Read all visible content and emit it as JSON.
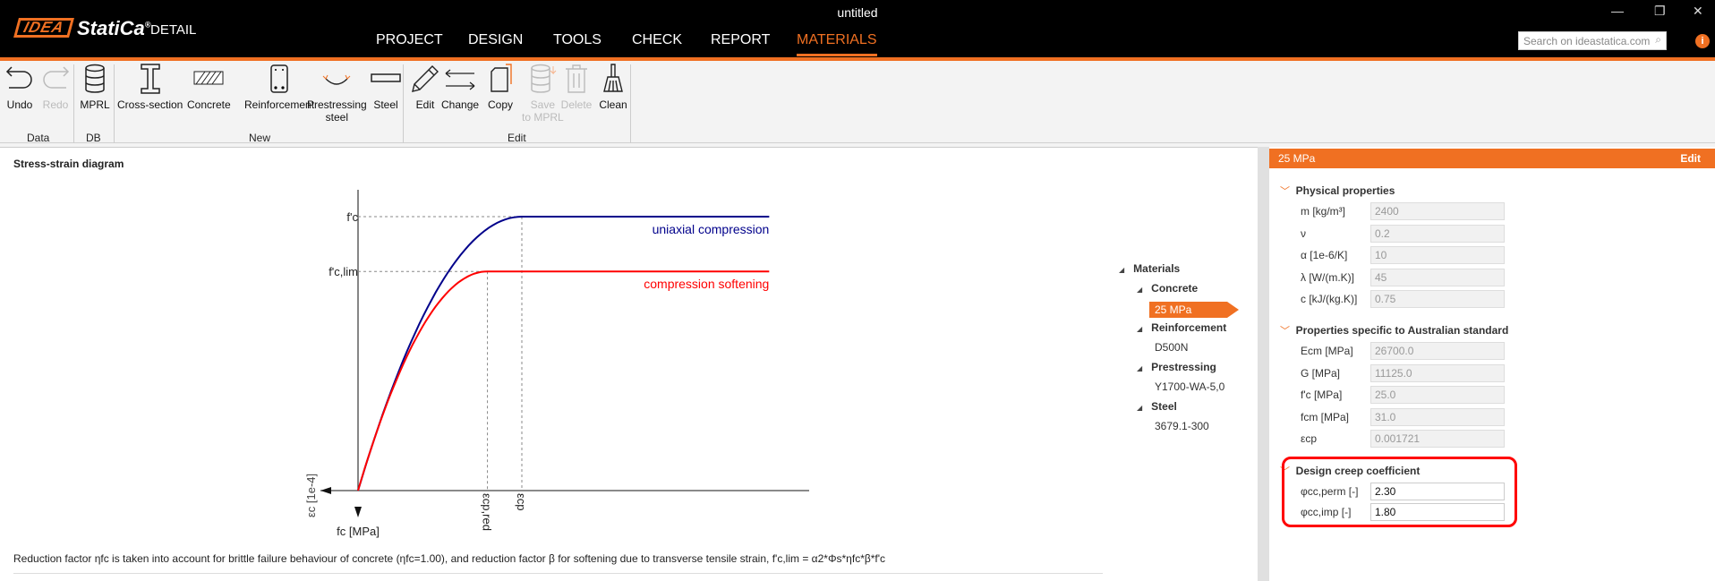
{
  "app": {
    "logo_idea": "IDEA",
    "logo_statica": "StatiCa",
    "logo_reg": "®",
    "product": "DETAIL",
    "window_title": "untitled",
    "tabs": [
      "PROJECT",
      "DESIGN",
      "TOOLS",
      "CHECK",
      "REPORT",
      "MATERIALS"
    ],
    "active_tab": "MATERIALS",
    "search_placeholder": "Search on ideastatica.com",
    "accent": "#f07022"
  },
  "ribbon": {
    "undo": "Undo",
    "redo": "Redo",
    "mprl": "MPRL",
    "cross_section": "Cross-section",
    "concrete": "Concrete",
    "reinforcement": "Reinforcement",
    "prestressing_1": "Prestressing",
    "prestressing_2": "steel",
    "steel": "Steel",
    "edit": "Edit",
    "change": "Change",
    "copy": "Copy",
    "save_1": "Save",
    "save_2": "to MPRL",
    "delete": "Delete",
    "clean": "Clean",
    "groups": {
      "data": "Data",
      "db": "DB",
      "new": "New",
      "edit": "Edit"
    }
  },
  "diagram": {
    "title": "Stress-strain diagram",
    "note": "Reduction factor ηfc is taken into account for brittle failure behaviour of concrete (ηfc=1.00), and reduction factor β for softening due to transverse tensile strain, f'c,lim = α2*Φs*ηfc*β*f'c"
  },
  "chart_data": {
    "type": "line",
    "title": "Stress-strain diagram",
    "xlabel": "εc [1e-4]",
    "ylabel": "fc [MPa]",
    "y_ticks": [
      "f'c",
      "f'c,lim"
    ],
    "y_tick_values": [
      1.0,
      0.8
    ],
    "x_ticks": [
      "εcp,red",
      "εcp"
    ],
    "x_tick_values": [
      0.79,
      1.0
    ],
    "xlim": [
      0,
      2.51
    ],
    "ylim": [
      0,
      1.0
    ],
    "series": [
      {
        "name": "uniaxial compression",
        "color": "#00008b",
        "peak_strain": 1.0,
        "peak_stress": 1.0,
        "x": [
          0,
          0.25,
          0.5,
          0.75,
          1.0,
          2.51
        ],
        "y": [
          0,
          0.4375,
          0.75,
          0.9375,
          1.0,
          1.0
        ]
      },
      {
        "name": "compression softening",
        "color": "#ff0000",
        "peak_strain": 0.79,
        "peak_stress": 0.8,
        "x": [
          0,
          0.2,
          0.4,
          0.6,
          0.79,
          2.51
        ],
        "y": [
          0,
          0.35,
          0.6,
          0.75,
          0.8,
          0.8
        ]
      }
    ]
  },
  "tree": {
    "root": "Materials",
    "groups": [
      {
        "name": "Concrete",
        "items": [
          "25 MPa"
        ]
      },
      {
        "name": "Reinforcement",
        "items": [
          "D500N"
        ]
      },
      {
        "name": "Prestressing",
        "items": [
          "Y1700-WA-5,0"
        ]
      },
      {
        "name": "Steel",
        "items": [
          "3679.1-300"
        ]
      }
    ]
  },
  "props": {
    "header": "25 MPa",
    "edit": "Edit",
    "physical": {
      "title": "Physical properties",
      "rows": [
        {
          "label": "m [kg/m³]",
          "value": "2400"
        },
        {
          "label": "ν",
          "value": "0.2"
        },
        {
          "label": "α [1e-6/K]",
          "value": "10"
        },
        {
          "label": "λ [W/(m.K)]",
          "value": "45"
        },
        {
          "label": "c [kJ/(kg.K)]",
          "value": "0.75"
        }
      ]
    },
    "australian": {
      "title": "Properties specific to Australian standard",
      "rows": [
        {
          "label": "Ecm [MPa]",
          "value": "26700.0"
        },
        {
          "label": "G [MPa]",
          "value": "11125.0"
        },
        {
          "label": "f'c [MPa]",
          "value": "25.0"
        },
        {
          "label": "fcm [MPa]",
          "value": "31.0"
        },
        {
          "label": "εcp",
          "value": "0.001721"
        }
      ]
    },
    "creep": {
      "title": "Design creep coefficient",
      "rows": [
        {
          "label": "φcc,perm [-]",
          "value": "2.30"
        },
        {
          "label": "φcc,imp [-]",
          "value": "1.80"
        }
      ]
    }
  }
}
